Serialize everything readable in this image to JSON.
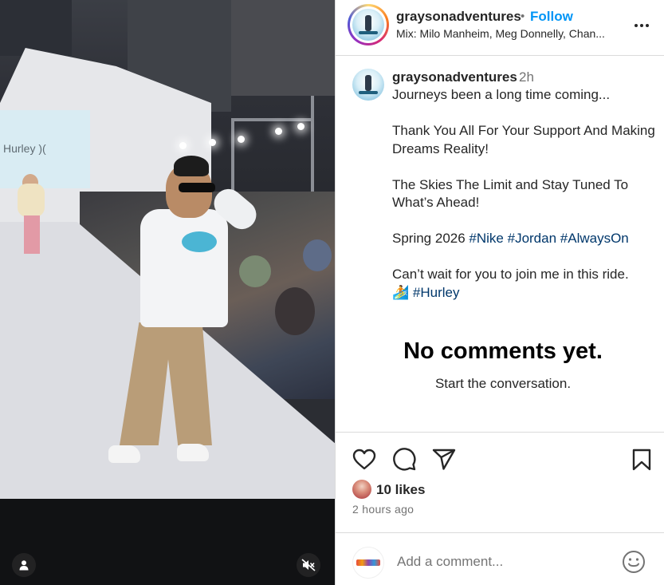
{
  "post": {
    "username": "graysonadventures",
    "separator": "•",
    "follow_label": "Follow",
    "music": "Mix: Milo Manheim, Meg Donnelly, Chan...",
    "caption_username": "graysonadventures",
    "caption_time": "2h",
    "caption_lines": {
      "l1": "Journeys been a long time coming...",
      "l2": "Thank You All For Your Support And Making Dreams Reality!",
      "l3": "The Skies The Limit and Stay Tuned To What’s Ahead!",
      "l4_prefix": "Spring 2026 ",
      "l5": "Can’t wait for you to join me in this ride.",
      "l6_emoji": "🏄"
    },
    "hashtags": {
      "nike": "#Nike",
      "jordan": "#Jordan",
      "alwayson": "#AlwaysOn",
      "hurley": "#Hurley"
    },
    "no_comments_title": "No comments yet.",
    "no_comments_sub": "Start the conversation.",
    "likes": "10 likes",
    "time_ago": "2 hours ago",
    "comment_placeholder": "Add a comment..."
  },
  "media": {
    "brand_text": "Hurley )("
  },
  "icons": {
    "header_more": "more-icon",
    "like": "heart-icon",
    "comment": "comment-icon",
    "share": "share-icon",
    "save": "bookmark-icon",
    "emoji": "emoji-icon",
    "mute": "muted-speaker-icon",
    "tagged": "person-icon"
  },
  "colors": {
    "link_blue": "#0095f6",
    "hashtag": "#00376b",
    "secondary_text": "#737373",
    "border": "#dbdbdb"
  }
}
